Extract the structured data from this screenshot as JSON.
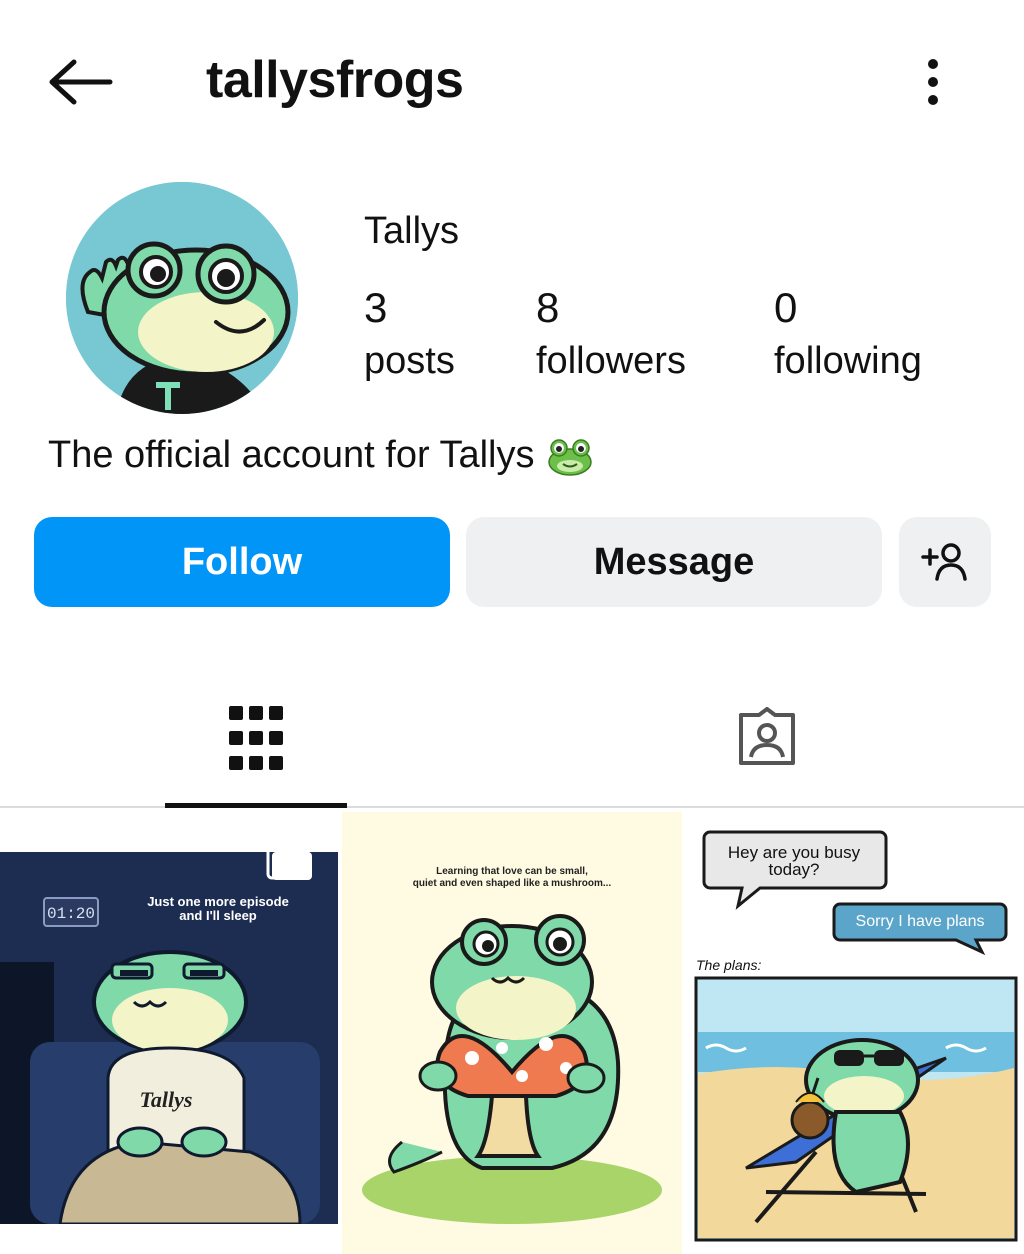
{
  "header": {
    "username": "tallysfrogs"
  },
  "profile": {
    "display_name": "Tallys",
    "stats": {
      "posts_count": "3",
      "posts_label": "posts",
      "followers_count": "8",
      "followers_label": "followers",
      "following_count": "0",
      "following_label": "following"
    },
    "bio": "The official account for Tallys",
    "bio_emoji": "frog-face"
  },
  "actions": {
    "follow_label": "Follow",
    "message_label": "Message"
  },
  "colors": {
    "follow_bg": "#0095f6",
    "secondary_bg": "#eef0f2",
    "avatar_bg": "#78c8d3",
    "frog_green": "#7fd9a8"
  },
  "tabs": {
    "active": "grid-icon",
    "items": [
      "grid-icon",
      "tagged-icon"
    ]
  },
  "posts": [
    {
      "timestamp": "01:20",
      "caption": "Just one more episode",
      "caption2": "and I'll sleep",
      "shirt_text": "Tallys",
      "multi_icon": "carousel-icon"
    },
    {
      "caption": "Learning that love can be small,",
      "caption2": "quiet and even shaped like a mushroom..."
    },
    {
      "bubble1_line1": "Hey are you busy",
      "bubble1_line2": "today?",
      "bubble2": "Sorry I have plans",
      "label": "The plans:"
    }
  ]
}
